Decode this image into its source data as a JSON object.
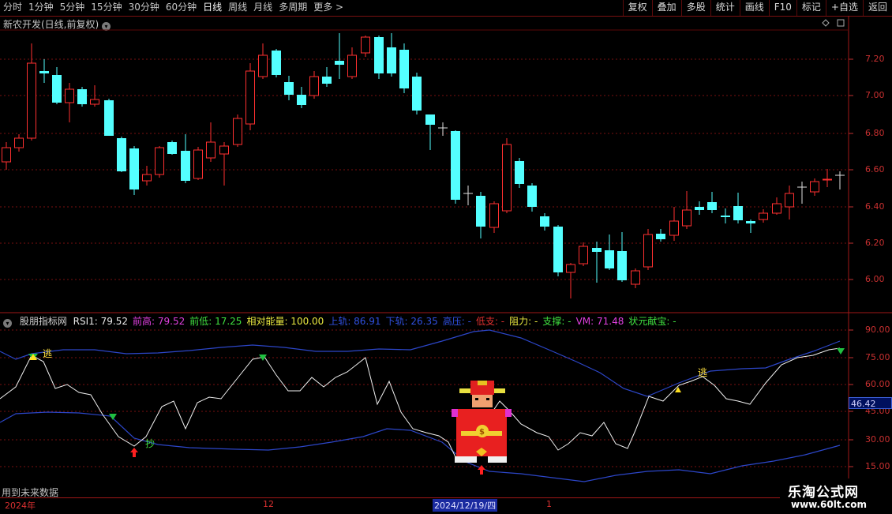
{
  "toolbar": {
    "tabs": [
      "分时",
      "1分钟",
      "5分钟",
      "15分钟",
      "30分钟",
      "60分钟",
      "日线",
      "周线",
      "月线",
      "多周期",
      "更多 >"
    ],
    "active": "日线",
    "right": [
      "复权",
      "叠加",
      "多股",
      "统计",
      "画线",
      "F10",
      "标记",
      "+自选",
      "返回"
    ]
  },
  "main": {
    "title": "新农开发(日线,前复权)",
    "circle_icon": "chevron-down-icon"
  },
  "price_axis": [
    "7.20",
    "7.00",
    "6.80",
    "6.60",
    "6.40",
    "6.20",
    "6.00"
  ],
  "indicator": {
    "name": "股朋指标网",
    "items": [
      {
        "label": "RSI1: 79.52",
        "color": "#e8e8e8"
      },
      {
        "label": "前高: 79.52",
        "color": "#e040e0"
      },
      {
        "label": "前低: 17.25",
        "color": "#40e040"
      },
      {
        "label": "相对能量: 100.00",
        "color": "#e8e840"
      },
      {
        "label": "上轨: 86.91",
        "color": "#3050e0"
      },
      {
        "label": "下轨: 26.35",
        "color": "#3050e0"
      },
      {
        "label": "高压: -",
        "color": "#3050e0"
      },
      {
        "label": "低支: -",
        "color": "#e03030"
      },
      {
        "label": "阻力: -",
        "color": "#e8e840"
      },
      {
        "label": "支撑: -",
        "color": "#40e040"
      },
      {
        "label": "VM: 71.48",
        "color": "#e040e0"
      },
      {
        "label": "状元献宝: -",
        "color": "#40e040"
      }
    ],
    "axis": [
      "90.00",
      "75.00",
      "60.00",
      "45.00",
      "30.00",
      "15.00"
    ],
    "current_value": "46.42",
    "escape_label": "逃",
    "buy_label": "抄"
  },
  "footer": {
    "future_note": "用到未来数据",
    "dates": [
      "2024年",
      "12",
      "1"
    ],
    "selected_date": "2024/12/19/四"
  },
  "watermark": {
    "name": "乐淘公式网",
    "url": "www.60lt.com"
  },
  "colors": {
    "up": "#ff3030",
    "down": "#54ffff",
    "bg": "#000000",
    "grid": "#7a1010"
  }
}
